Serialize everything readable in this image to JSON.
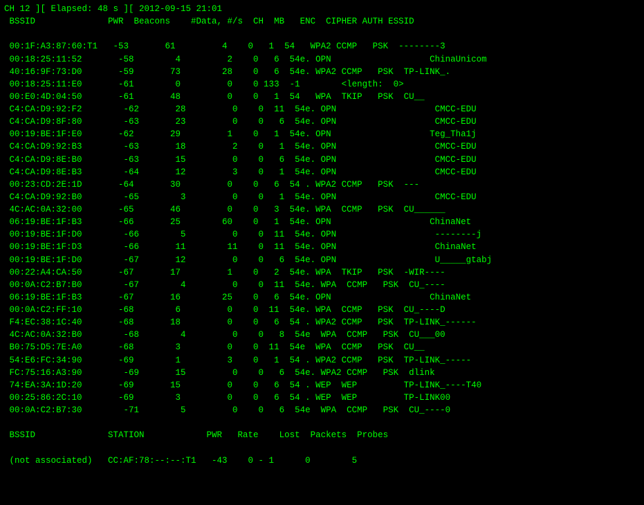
{
  "terminal": {
    "title": "CH 12 ][ Elapsed: 48 s ][ 2012-09-15 21:01",
    "column_headers": " BSSID              PWR  Beacons    #Data, #/s  CH  MB   ENC  CIPHER AUTH ESSID",
    "blank1": "",
    "rows": [
      " 00:1F:A3:87:60:T1   -53       61         4    0   1  54   WPA2 CCMP   PSK  --------3",
      " 00:18:25:11:52       -58        4         2    0   6  54e. OPN                   ChinaUnicom",
      " 40:16:9F:73:D0       -59       73        28    0   6  54e. WPA2 CCMP   PSK  TP-LINK_.",
      " 00:18:25:11:E0       -61        0         0    0 133  -1        <length:  0>",
      " 00:E0:4D:04:50       -61       48         0    0   1  54   WPA  TKIP   PSK  CU__",
      " C4:CA:D9:92:F2        -62       28         0    0  11  54e. OPN                   CMCC-EDU",
      " C4:CA:D9:8F:80        -63       23         0    0   6  54e. OPN                   CMCC-EDU",
      " 00:19:BE:1F:E0       -62       29         1    0   1  54e. OPN                   Teg_Tha1j",
      " C4:CA:D9:92:B3        -63       18         2    0   1  54e. OPN                   CMCC-EDU",
      " C4:CA:D9:8E:B0        -63       15         0    0   6  54e. OPN                   CMCC-EDU",
      " C4:CA:D9:8E:B3        -64       12         3    0   1  54e. OPN                   CMCC-EDU",
      " 00:23:CD:2E:1D       -64       30         0    0   6  54 . WPA2 CCMP   PSK  ---",
      " C4:CA:D9:92:B0        -65        3         0    0   1  54e. OPN                   CMCC-EDU",
      " 4C:AC:0A:32:00       -65       46         0    0   3  54e. WPA  CCMP   PSK  CU______",
      " 06:19:BE:1F:B3       -66       25        60    0   1  54e. OPN                   ChinaNet",
      " 00:19:BE:1F:D0        -66        5         0    0  11  54e. OPN                   --------j",
      " 00:19:BE:1F:D3        -66       11        11    0  11  54e. OPN                   ChinaNet",
      " 00:19:BE:1F:D0        -67       12         0    0   6  54e. OPN                   U_____gtabj",
      " 00:22:A4:CA:50       -67       17         1    0   2  54e. WPA  TKIP   PSK  -WIR----",
      " 00:0A:C2:B7:B0        -67        4         0    0  11  54e. WPA  CCMP   PSK  CU_----",
      " 06:19:BE:1F:B3       -67       16        25    0   6  54e. OPN                   ChinaNet",
      " 00:0A:C2:FF:10       -68        6         0    0  11  54e. WPA  CCMP   PSK  CU_----D",
      " F4:EC:38:1C:40       -68       18         0    0   6  54 . WPA2 CCMP   PSK  TP-LINK_------",
      " 4C:AC:0A:32:B0        -68        4         0    0   8  54e  WPA  CCMP   PSK  CU___00",
      " B0:75:D5:7E:A0       -68        3         0    0  11  54e  WPA  CCMP   PSK  CU__",
      " 54:E6:FC:34:90       -69        1         3    0   1  54 . WPA2 CCMP   PSK  TP-LINK_-----",
      " FC:75:16:A3:90        -69       15         0    0   6  54e. WPA2 CCMP   PSK  dlink",
      " 74:EA:3A:1D:20       -69       15         0    0   6  54 . WEP  WEP         TP-LINK_----T40",
      " 00:25:86:2C:10       -69        3         0    0   6  54 . WEP  WEP         TP-LINK00",
      " 00:0A:C2:B7:30        -71        5         0    0   6  54e  WPA  CCMP   PSK  CU_----0"
    ],
    "blank2": "",
    "station_header": " BSSID              STATION            PWR   Rate    Lost  Packets  Probes",
    "blank3": "",
    "station_rows": [
      " (not associated)   CC:AF:78:--:--:T1   -43    0 - 1      0        5"
    ]
  }
}
